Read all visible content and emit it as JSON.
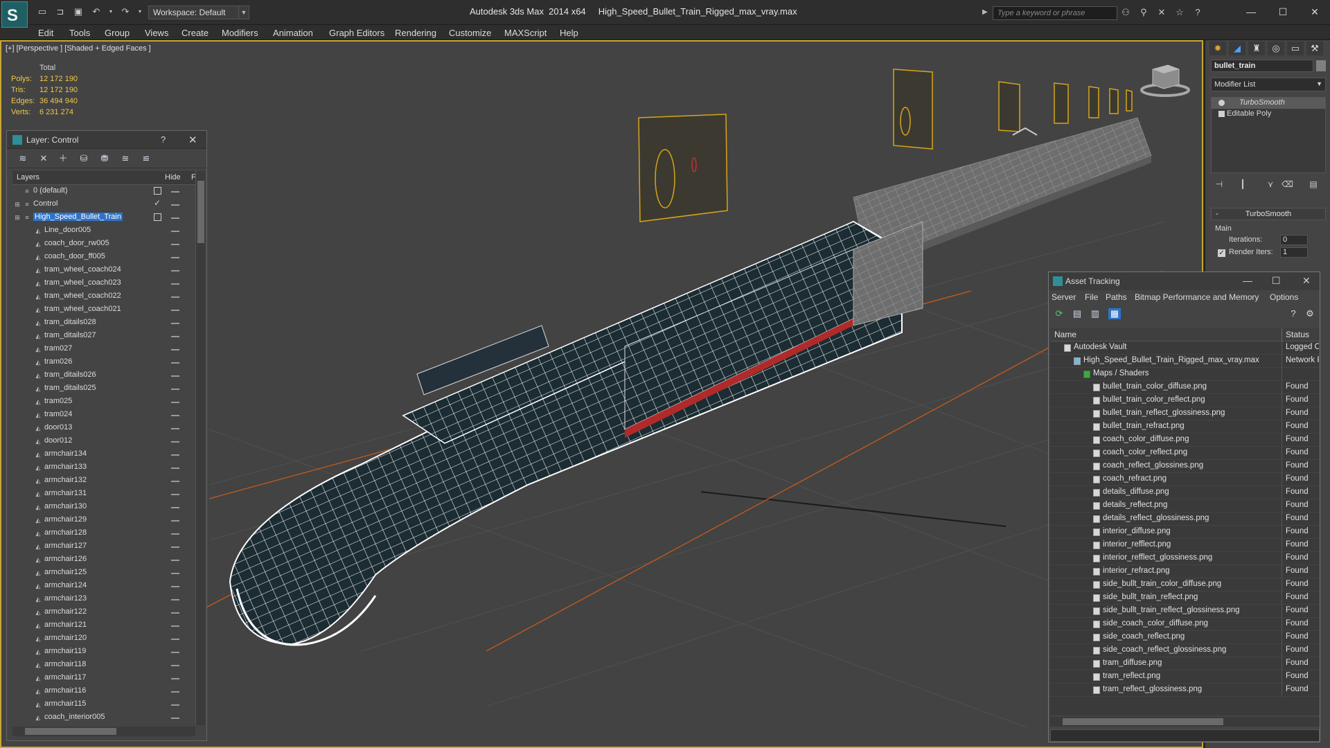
{
  "titlebar": {
    "logo_glyph": "S",
    "workspace": "Workspace: Default",
    "title": "Autodesk 3ds Max  2014 x64     High_Speed_Bullet_Train_Rigged_max_vray.max",
    "search_placeholder": "Type a keyword or phrase",
    "minimize": "—",
    "maximize": "☐",
    "close": "✕"
  },
  "menu": [
    "Edit",
    "Tools",
    "Group",
    "Views",
    "Create",
    "Modifiers",
    "Animation",
    "Graph Editors",
    "Rendering",
    "Customize",
    "MAXScript",
    "Help"
  ],
  "viewport": {
    "label": "[+] [Perspective ] [Shaded + Edged Faces ]",
    "stats": {
      "header": "Total",
      "rows": [
        {
          "label": "Polys:",
          "value": "12 172 190"
        },
        {
          "label": "Tris:",
          "value": "12 172 190"
        },
        {
          "label": "Edges:",
          "value": "36 494 940"
        },
        {
          "label": "Verts:",
          "value": "6 231 274"
        }
      ]
    }
  },
  "layer_panel": {
    "title": "Layer: Control",
    "help": "?",
    "close": "✕",
    "col_layers": "Layers",
    "col_hide": "Hide",
    "col_f": "F",
    "rows": [
      {
        "name": "0 (default)",
        "level": 0,
        "box": true
      },
      {
        "name": "Control",
        "level": 0,
        "check": true,
        "expander": true
      },
      {
        "name": "High_Speed_Bullet_Train",
        "level": 0,
        "box": true,
        "selected": true,
        "expander": true
      },
      {
        "name": "Line_door005",
        "level": 1
      },
      {
        "name": "coach_door_rw005",
        "level": 1
      },
      {
        "name": "coach_door_ff005",
        "level": 1
      },
      {
        "name": "tram_wheel_coach024",
        "level": 1
      },
      {
        "name": "tram_wheel_coach023",
        "level": 1
      },
      {
        "name": "tram_wheel_coach022",
        "level": 1
      },
      {
        "name": "tram_wheel_coach021",
        "level": 1
      },
      {
        "name": "tram_ditails028",
        "level": 1
      },
      {
        "name": "tram_ditails027",
        "level": 1
      },
      {
        "name": "tram027",
        "level": 1
      },
      {
        "name": "tram026",
        "level": 1
      },
      {
        "name": "tram_ditails026",
        "level": 1
      },
      {
        "name": "tram_ditails025",
        "level": 1
      },
      {
        "name": "tram025",
        "level": 1
      },
      {
        "name": "tram024",
        "level": 1
      },
      {
        "name": "door013",
        "level": 1
      },
      {
        "name": "door012",
        "level": 1
      },
      {
        "name": "armchair134",
        "level": 1
      },
      {
        "name": "armchair133",
        "level": 1
      },
      {
        "name": "armchair132",
        "level": 1
      },
      {
        "name": "armchair131",
        "level": 1
      },
      {
        "name": "armchair130",
        "level": 1
      },
      {
        "name": "armchair129",
        "level": 1
      },
      {
        "name": "armchair128",
        "level": 1
      },
      {
        "name": "armchair127",
        "level": 1
      },
      {
        "name": "armchair126",
        "level": 1
      },
      {
        "name": "armchair125",
        "level": 1
      },
      {
        "name": "armchair124",
        "level": 1
      },
      {
        "name": "armchair123",
        "level": 1
      },
      {
        "name": "armchair122",
        "level": 1
      },
      {
        "name": "armchair121",
        "level": 1
      },
      {
        "name": "armchair120",
        "level": 1
      },
      {
        "name": "armchair119",
        "level": 1
      },
      {
        "name": "armchair118",
        "level": 1
      },
      {
        "name": "armchair117",
        "level": 1
      },
      {
        "name": "armchair116",
        "level": 1
      },
      {
        "name": "armchair115",
        "level": 1
      },
      {
        "name": "coach_interior005",
        "level": 1
      }
    ]
  },
  "command_panel": {
    "object_name": "bullet_train",
    "modifier_list": "Modifier List",
    "stack": [
      {
        "label": "TurboSmooth",
        "active": true
      },
      {
        "label": "Editable Poly",
        "active": false
      }
    ],
    "rollout_title": "TurboSmooth",
    "main_label": "Main",
    "iterations_label": "Iterations:",
    "iterations_value": "0",
    "render_iters_label": "Render Iters:",
    "render_iters_value": "1",
    "render_iters_checked": true
  },
  "asset_tracking": {
    "title": "Asset Tracking",
    "menu": [
      "Server",
      "File",
      "Paths",
      "Bitmap Performance and Memory",
      "Options"
    ],
    "col_name": "Name",
    "col_status": "Status",
    "rows": [
      {
        "name": "Autodesk Vault",
        "status": "Logged Out",
        "level": 0
      },
      {
        "name": "High_Speed_Bullet_Train_Rigged_max_vray.max",
        "status": "Network Path",
        "level": 1
      },
      {
        "name": "Maps / Shaders",
        "status": "",
        "level": 2
      },
      {
        "name": "bullet_train_color_diffuse.png",
        "status": "Found",
        "level": 3
      },
      {
        "name": "bullet_train_color_reflect.png",
        "status": "Found",
        "level": 3
      },
      {
        "name": "bullet_train_reflect_glossiness.png",
        "status": "Found",
        "level": 3
      },
      {
        "name": "bullet_train_refract.png",
        "status": "Found",
        "level": 3
      },
      {
        "name": "coach_color_diffuse.png",
        "status": "Found",
        "level": 3
      },
      {
        "name": "coach_color_reflect.png",
        "status": "Found",
        "level": 3
      },
      {
        "name": "coach_reflect_glossines.png",
        "status": "Found",
        "level": 3
      },
      {
        "name": "coach_refract.png",
        "status": "Found",
        "level": 3
      },
      {
        "name": "details_diffuse.png",
        "status": "Found",
        "level": 3
      },
      {
        "name": "details_reflect.png",
        "status": "Found",
        "level": 3
      },
      {
        "name": "details_reflect_glossiness.png",
        "status": "Found",
        "level": 3
      },
      {
        "name": "interior_diffuse.png",
        "status": "Found",
        "level": 3
      },
      {
        "name": "interior_refflect.png",
        "status": "Found",
        "level": 3
      },
      {
        "name": "interior_refflect_glossiness.png",
        "status": "Found",
        "level": 3
      },
      {
        "name": "interior_refract.png",
        "status": "Found",
        "level": 3
      },
      {
        "name": "side_bullt_train_color_diffuse.png",
        "status": "Found",
        "level": 3
      },
      {
        "name": "side_bullt_train_reflect.png",
        "status": "Found",
        "level": 3
      },
      {
        "name": "side_bullt_train_reflect_glossiness.png",
        "status": "Found",
        "level": 3
      },
      {
        "name": "side_coach_color_diffuse.png",
        "status": "Found",
        "level": 3
      },
      {
        "name": "side_coach_reflect.png",
        "status": "Found",
        "level": 3
      },
      {
        "name": "side_coach_reflect_glossiness.png",
        "status": "Found",
        "level": 3
      },
      {
        "name": "tram_diffuse.png",
        "status": "Found",
        "level": 3
      },
      {
        "name": "tram_reflect.png",
        "status": "Found",
        "level": 3
      },
      {
        "name": "tram_reflect_glossiness.png",
        "status": "Found",
        "level": 3
      }
    ]
  },
  "colors": {
    "viewport_bg": "#434343",
    "active_border": "#c9a833",
    "stats_text": "#f0c94c",
    "selection": "#2f73c9",
    "wire": "#ffffff"
  }
}
